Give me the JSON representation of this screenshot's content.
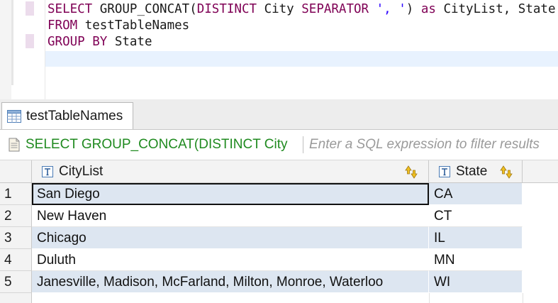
{
  "editor": {
    "lines": [
      [
        {
          "t": "SELECT ",
          "c": "kw"
        },
        {
          "t": "GROUP_CONCAT(",
          "c": ""
        },
        {
          "t": "DISTINCT ",
          "c": "kw"
        },
        {
          "t": "City ",
          "c": ""
        },
        {
          "t": "SEPARATOR ",
          "c": "kw"
        },
        {
          "t": "', '",
          "c": "str"
        },
        {
          "t": ") ",
          "c": ""
        },
        {
          "t": "as ",
          "c": "kw"
        },
        {
          "t": "CityList, State",
          "c": ""
        }
      ],
      [
        {
          "t": "FROM ",
          "c": "kw"
        },
        {
          "t": "testTableNames",
          "c": ""
        }
      ],
      [
        {
          "t": "GROUP BY ",
          "c": "kw"
        },
        {
          "t": "State",
          "c": ""
        }
      ]
    ]
  },
  "tab": {
    "label": "testTableNames"
  },
  "filter": {
    "query_text": "SELECT GROUP_CONCAT(DISTINCT City",
    "placeholder": "Enter a SQL expression to filter results"
  },
  "grid": {
    "columns": [
      {
        "label": "CityList",
        "icon": "text-type-icon"
      },
      {
        "label": "State",
        "icon": "text-type-icon"
      }
    ],
    "rows": [
      {
        "num": "1",
        "citylist": "San Diego",
        "state": "CA"
      },
      {
        "num": "2",
        "citylist": "New Haven",
        "state": "CT"
      },
      {
        "num": "3",
        "citylist": "Chicago",
        "state": "IL"
      },
      {
        "num": "4",
        "citylist": "Duluth",
        "state": "MN"
      },
      {
        "num": "5",
        "citylist": "Janesville, Madison, McFarland, Milton, Monroe, Waterloo",
        "state": "WI"
      }
    ]
  },
  "colors": {
    "keyword": "#7f0055",
    "string": "#2a00ff",
    "query_green": "#1f8a1f",
    "row_stripe": "#dde6f1"
  }
}
